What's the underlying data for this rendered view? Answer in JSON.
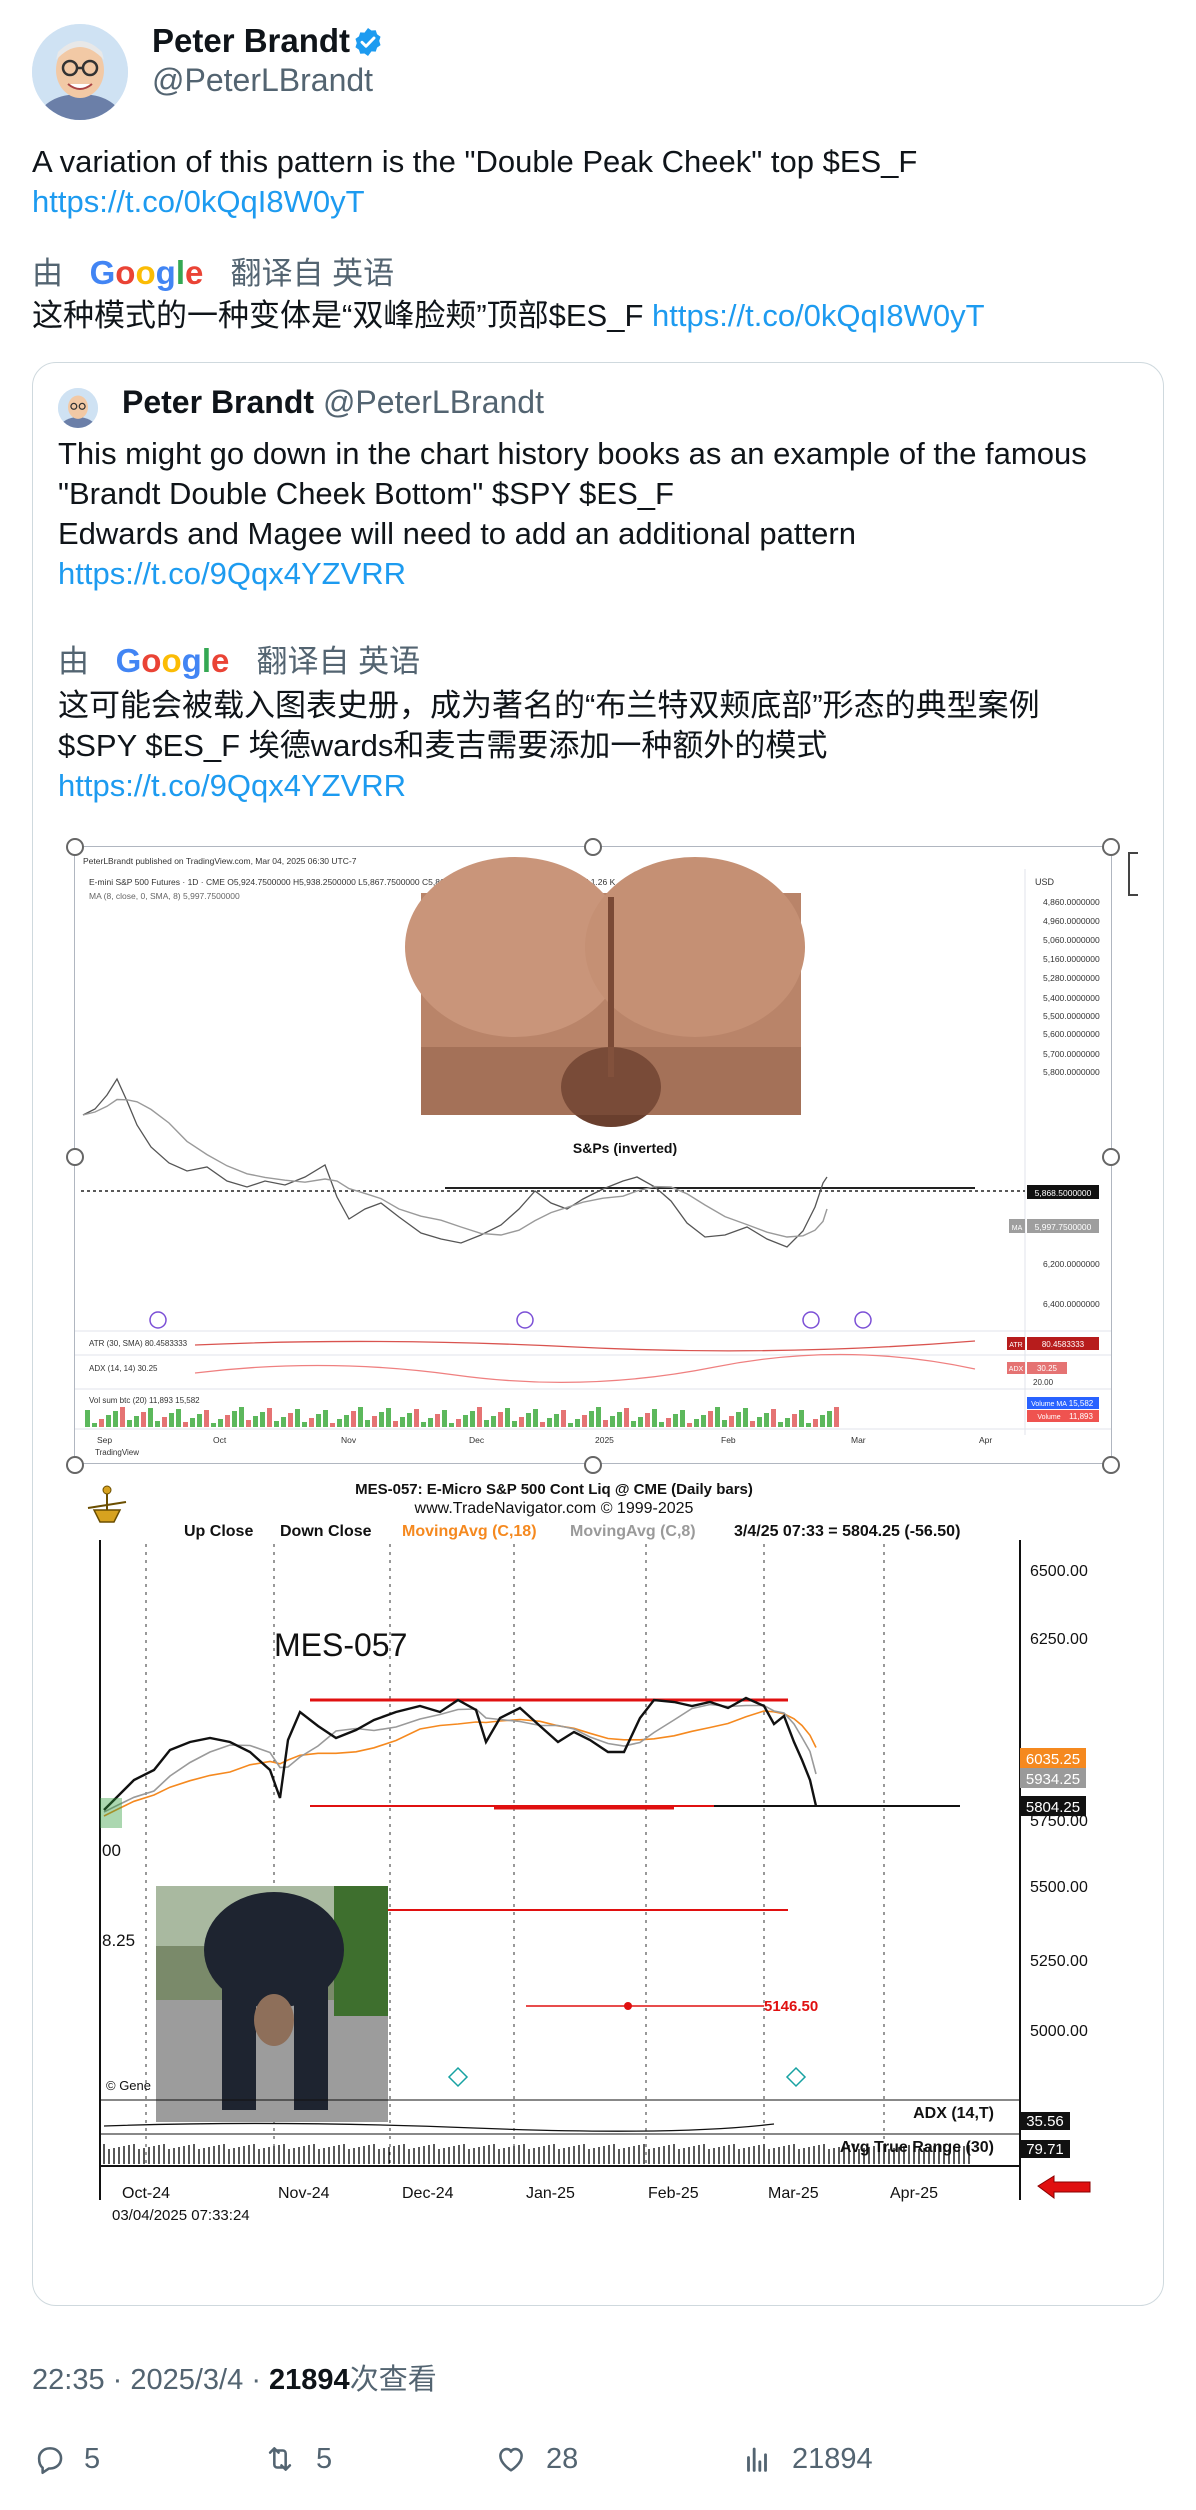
{
  "author": {
    "name": "Peter Brandt",
    "handle": "@PeterLBrandt",
    "avatar_icon": "avatar-face-icon",
    "verified_icon": "verified-badge-icon",
    "verified_color": "#1d9bf0"
  },
  "tweet": {
    "text": "A variation of this pattern is the \"Double Peak Cheek\" top $ES_F",
    "link": "https://t.co/0kQqI8W0yT",
    "translation_prefix": "由",
    "translation_brand": "Google",
    "translation_suffix": "翻译自 英语",
    "translated_text": "这种模式的一种变体是“双峰脸颊”顶部$ES_F",
    "translated_link": "https://t.co/0kQqI8W0yT"
  },
  "quote": {
    "name": "Peter Brandt",
    "handle": "@PeterLBrandt",
    "text_line1": "This might go down in the chart history books as an example of the famous",
    "text_line2": "\"Brandt Double Cheek Bottom\" $SPY $ES_F",
    "text_line3": "Edwards and Magee will need to add an additional pattern",
    "link": "https://t.co/9Qqx4YZVRR",
    "translation_prefix": "由",
    "translation_brand": "Google",
    "translation_suffix": "翻译自 英语",
    "translated_line1": "这可能会被载入图表史册，成为著名的“布兰特双颊底部”形态的典型案例",
    "translated_line2": "$SPY $ES_F 埃德wards和麦吉需要添加一种额外的模式",
    "translated_link": "https://t.co/9Qqx4YZVRR"
  },
  "chart1": {
    "header": "PeterLBrandt published on TradingView.com, Mar 04, 2025 06:30 UTC-7",
    "symbol_line": "E-mini S&P 500 Futures · 1D · CME  O5,924.7500000  H5,938.2500000  L5,867.7500000  C5,868.5000000  −62.0000000 (−1.05%)  Vol.1.26 K",
    "ma_line": "MA (8, close, 0, SMA, 8)  5,997.7500000",
    "currency": "USD",
    "annotation": "S&Ps (inverted)",
    "price_labels": [
      "4,860.0000000",
      "4,960.0000000",
      "5,060.0000000",
      "5,160.0000000",
      "5,280.0000000",
      "5,400.0000000",
      "5,500.0000000",
      "5,600.0000000",
      "5,700.0000000",
      "5,800.0000000",
      "5,868.5000000",
      "5,997.7500000",
      "6,200.0000000",
      "6,400.0000000"
    ],
    "last_price_tag": "5,868.5000000",
    "ma_tag": "5,997.7500000",
    "ma_tag_label": "MA",
    "atr_label": "ATR (30, SMA)  80.4583333",
    "atr_tag": "80.4583333",
    "atr_tag_label": "ATR",
    "adx_label": "ADX (14, 14)  30.25",
    "adx_tag": "30.25",
    "adx_tag_label": "ADX",
    "adx_level": "20.00",
    "vol_label": "Vol sum btc (20)  11,893  15,582",
    "vol_tag_ma": "15,582",
    "vol_tag": "11,893",
    "vol_tag_ma_label": "Volume MA",
    "vol_tag_label": "Volume",
    "months": [
      "Sep",
      "Oct",
      "Nov",
      "Dec",
      "2025",
      "Feb",
      "Mar",
      "Apr"
    ],
    "brand": "TradingView"
  },
  "chart2": {
    "title": "MES-057:  E-Micro S&P 500 Cont Liq @ CME  (Daily bars)",
    "subtitle": "www.TradeNavigator.com © 1999-2025",
    "legend_up": "Up Close",
    "legend_down": "Down Close",
    "legend_ma18": "MovingAvg (C,18)",
    "legend_ma8": "MovingAvg (C,8)",
    "legend_quote": "3/4/25 07:33 = 5804.25 (-56.50)",
    "symbol_label": "MES-057",
    "y_labels": [
      "6500.00",
      "6250.00",
      "6000.00",
      "5750.00",
      "5500.00",
      "5250.00",
      "5000.00"
    ],
    "tag_ma18": "6035.25",
    "tag_ma8": "5934.25",
    "tag_last": "5804.25",
    "left_cut_a": "00",
    "left_cut_b": "8.25",
    "target_label": "5146.50",
    "copyright_cut": "© Gene",
    "adx_label": "ADX (14,T)",
    "adx_value": "35.56",
    "atr_label": "Avg True Range (30)",
    "atr_value": "79.71",
    "months": [
      "Oct-24",
      "Nov-24",
      "Dec-24",
      "Jan-25",
      "Feb-25",
      "Mar-25",
      "Apr-25"
    ],
    "timestamp": "03/04/2025 07:33:24",
    "colors": {
      "red_line": "#e01010",
      "ma18": "#f5891f",
      "ma8": "#9a9a9a",
      "arrow": "#e01010"
    }
  },
  "meta": {
    "time": "22:35",
    "date": "2025/3/4",
    "views_count": "21894",
    "views_label": "次查看"
  },
  "actions": {
    "replies": "5",
    "retweets": "5",
    "likes": "28",
    "views": "21894"
  }
}
